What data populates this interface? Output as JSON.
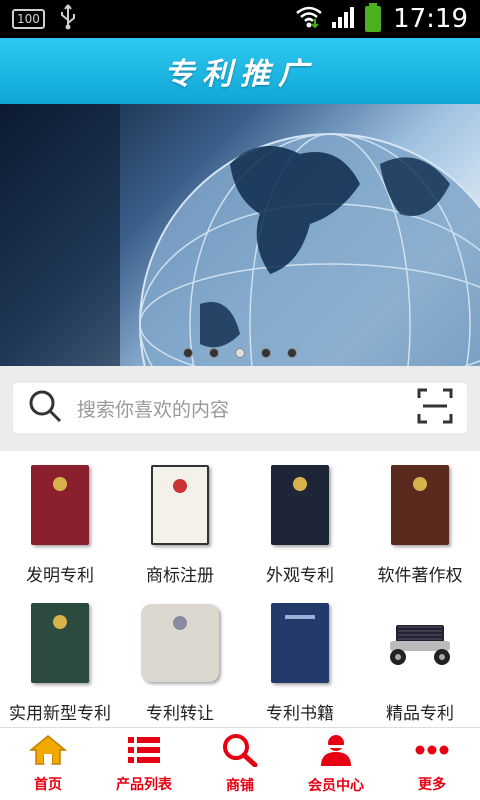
{
  "status": {
    "battery_small": "100",
    "time": "17:19"
  },
  "header": {
    "title": "专利推广"
  },
  "banner": {
    "slides": 5,
    "active_index": 2
  },
  "search": {
    "placeholder": "搜索你喜欢的内容"
  },
  "categories": [
    {
      "label": "发明专利",
      "cover": "#8a1f2e"
    },
    {
      "label": "商标注册",
      "cover": "#f4f1ea"
    },
    {
      "label": "外观专利",
      "cover": "#1e2536"
    },
    {
      "label": "软件著作权",
      "cover": "#5a2a1e"
    },
    {
      "label": "实用新型专利",
      "cover": "#2d4a3e"
    },
    {
      "label": "专利转让",
      "cover": "#dcd7cf"
    },
    {
      "label": "专利书籍",
      "cover": "#243a6a"
    },
    {
      "label": "精品专利",
      "cover": "#ffffff"
    }
  ],
  "tabbar": [
    {
      "label": "首页",
      "icon": "home-icon"
    },
    {
      "label": "产品列表",
      "icon": "list-icon"
    },
    {
      "label": "商铺",
      "icon": "search-icon"
    },
    {
      "label": "会员中心",
      "icon": "user-icon"
    },
    {
      "label": "更多",
      "icon": "more-icon"
    }
  ],
  "colors": {
    "accent": "#e60012",
    "header": "#10a6d6"
  }
}
